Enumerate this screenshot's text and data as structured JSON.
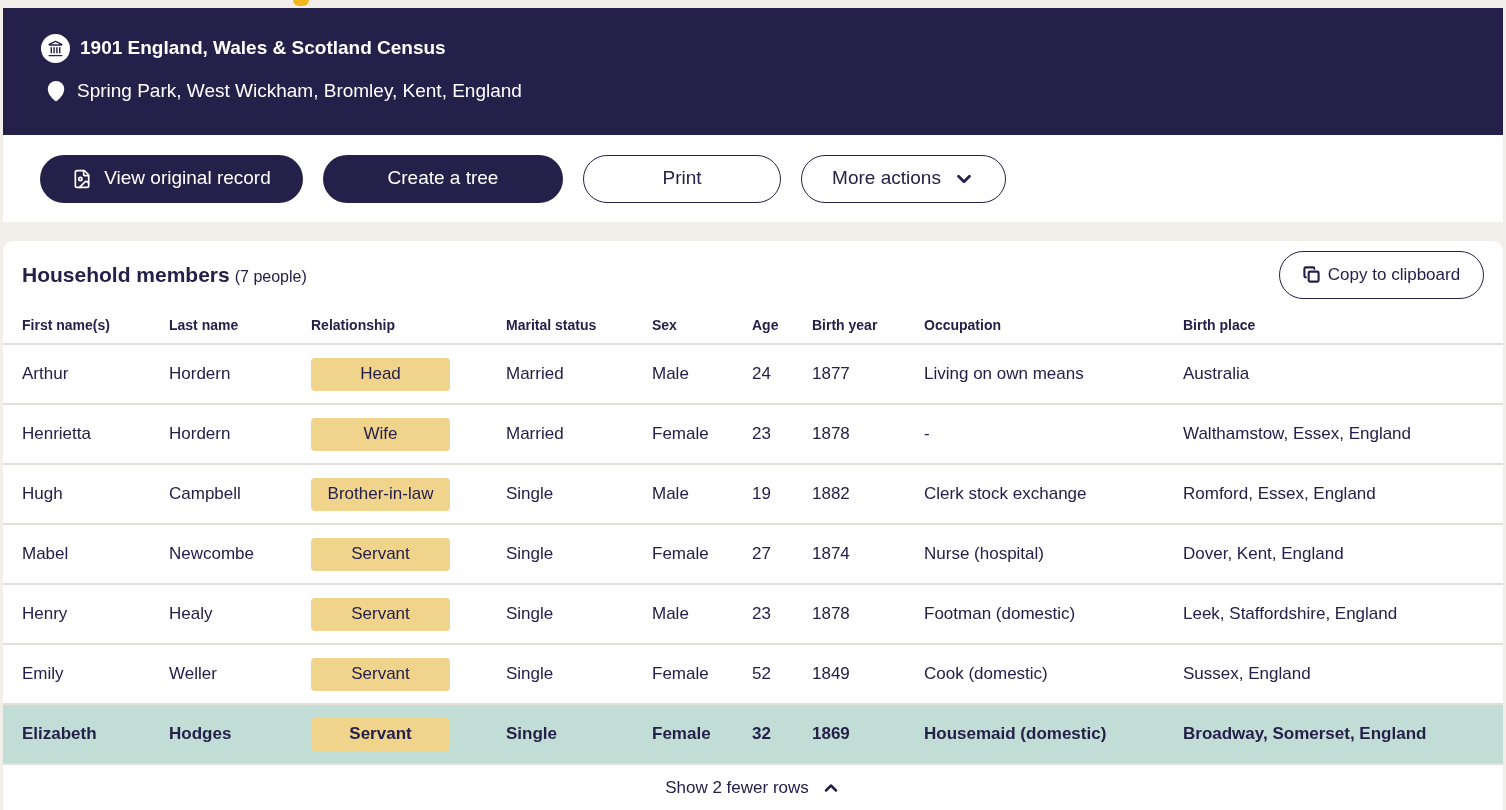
{
  "record": {
    "title": "1901 England, Wales & Scotland Census",
    "location": "Spring Park, West Wickham, Bromley, Kent, England"
  },
  "actions": [
    {
      "label": "View original record",
      "kind": "primary-icon"
    },
    {
      "label": "Create a tree",
      "kind": "primary"
    },
    {
      "label": "Print",
      "kind": "outline"
    },
    {
      "label": "More actions",
      "kind": "dropdown"
    }
  ],
  "household": {
    "title": "Household members",
    "count": "(7 people)",
    "copy_button": "Copy to clipboard",
    "columns": [
      "First name(s)",
      "Last name",
      "Relationship",
      "Marital status",
      "Sex",
      "Age",
      "Birth year",
      "Occupation",
      "Birth place"
    ],
    "rows": [
      {
        "cells": [
          "Arthur",
          "Hordern",
          "Head",
          "Married",
          "Male",
          "24",
          "1877",
          "Living on own means",
          "Australia"
        ],
        "selected": false
      },
      {
        "cells": [
          "Henrietta",
          "Hordern",
          "Wife",
          "Married",
          "Female",
          "23",
          "1878",
          "-",
          "Walthamstow, Essex, England"
        ],
        "selected": false
      },
      {
        "cells": [
          "Hugh",
          "Campbell",
          "Brother-in-law",
          "Single",
          "Male",
          "19",
          "1882",
          "Clerk stock exchange",
          "Romford, Essex, England"
        ],
        "selected": false
      },
      {
        "cells": [
          "Mabel",
          "Newcombe",
          "Servant",
          "Single",
          "Female",
          "27",
          "1874",
          "Nurse (hospital)",
          "Dover, Kent, England"
        ],
        "selected": false
      },
      {
        "cells": [
          "Henry",
          "Healy",
          "Servant",
          "Single",
          "Male",
          "23",
          "1878",
          "Footman (domestic)",
          "Leek, Staffordshire, England"
        ],
        "selected": false
      },
      {
        "cells": [
          "Emily",
          "Weller",
          "Servant",
          "Single",
          "Female",
          "52",
          "1849",
          "Cook (domestic)",
          "Sussex, England"
        ],
        "selected": false
      },
      {
        "cells": [
          "Elizabeth",
          "Hodges",
          "Servant",
          "Single",
          "Female",
          "32",
          "1869",
          "Housemaid (domestic)",
          "Broadway, Somerset, England"
        ],
        "selected": true
      }
    ],
    "toggle": "Show 2 fewer rows"
  }
}
